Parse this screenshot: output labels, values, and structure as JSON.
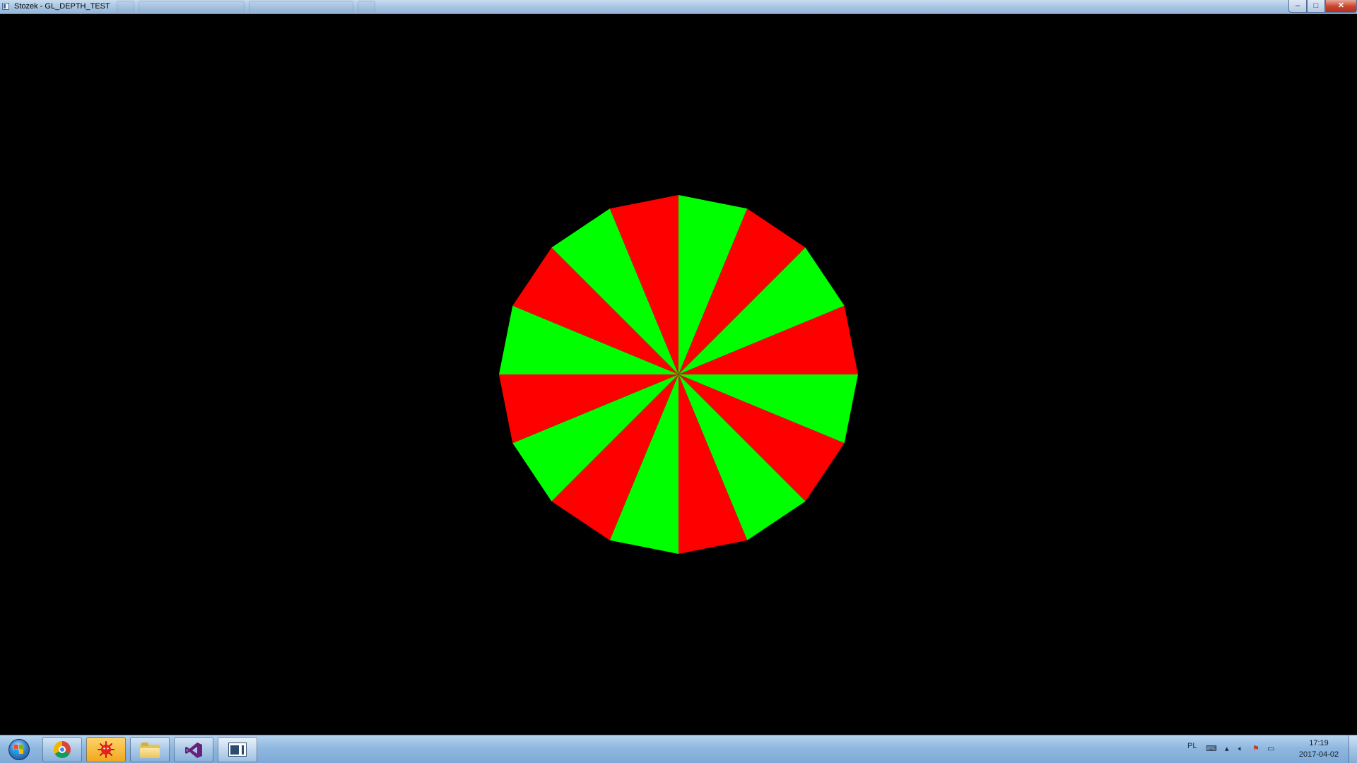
{
  "window": {
    "title": "Stozek - GL_DEPTH_TEST",
    "controls": {
      "minimize": "–",
      "maximize": "□",
      "close": "✕"
    }
  },
  "scene": {
    "segments": 16,
    "colors": {
      "primary": "#00ff00",
      "secondary": "#ff0000",
      "background": "#000000"
    }
  },
  "taskbar": {
    "buttons": [
      {
        "name": "chrome",
        "icon": "chrome-icon"
      },
      {
        "name": "bug-app",
        "icon": "bug-icon"
      },
      {
        "name": "explorer",
        "icon": "folder-icon"
      },
      {
        "name": "visual-studio",
        "icon": "visual-studio-icon"
      },
      {
        "name": "console",
        "icon": "console-window-icon"
      }
    ],
    "tray": {
      "language": "PL",
      "time": "17:19",
      "date": "2017-04-02"
    }
  }
}
